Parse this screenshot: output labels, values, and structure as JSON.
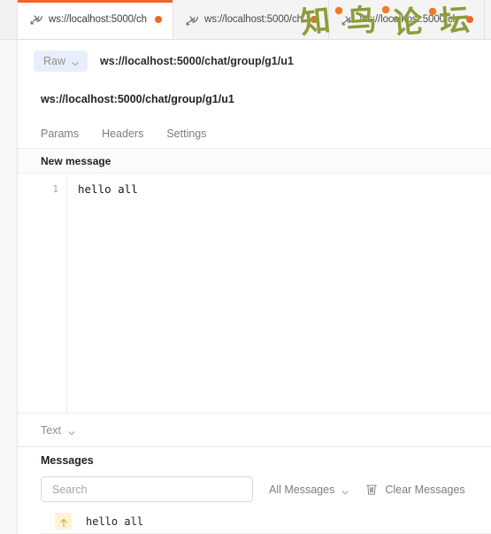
{
  "window": {
    "accent_color": "#f26522",
    "status_dot_color": "#f26522"
  },
  "tabs": [
    {
      "label": "ws://localhost:5000/ch",
      "icon": "websocket-icon",
      "status": "connected",
      "active": true
    },
    {
      "label": "ws://localhost:5000/ch",
      "icon": "websocket-icon",
      "status": "connected",
      "active": false
    },
    {
      "label": "ws://localhost:5000/ch",
      "icon": "websocket-icon",
      "status": "connected",
      "active": false
    }
  ],
  "urlbar": {
    "protocol_label": "Raw",
    "url": "ws://localhost:5000/chat/group/g1/u1",
    "chevron_icon": "chevron-down-icon"
  },
  "url_heading": "ws://localhost:5000/chat/group/g1/u1",
  "subtabs": [
    {
      "label": "Params"
    },
    {
      "label": "Headers"
    },
    {
      "label": "Settings"
    }
  ],
  "new_message": {
    "title": "New message",
    "line_numbers": [
      "1"
    ],
    "lines": [
      "hello all"
    ],
    "content_type": "Text",
    "content_type_chevron": "chevron-down-icon"
  },
  "messages": {
    "title": "Messages",
    "search_placeholder": "Search",
    "search_value": "",
    "filter_label": "All Messages",
    "filter_chevron": "chevron-down-icon",
    "clear_label": "Clear Messages",
    "clear_icon": "trash-icon",
    "rows": [
      {
        "direction": "sent",
        "direction_icon": "arrow-up-icon",
        "text": "hello all"
      }
    ]
  },
  "watermark": {
    "text": "知鸟论坛",
    "color": "#8e9c3a",
    "dot_color": "#ef7a2a"
  }
}
